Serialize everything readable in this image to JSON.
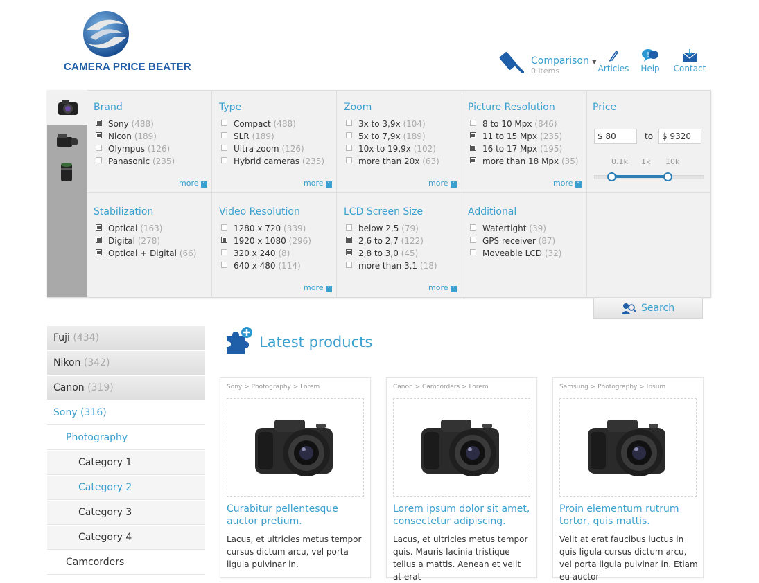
{
  "brand": {
    "name": "CAMERA PRICE BEATER"
  },
  "header": {
    "comparison": {
      "label": "Comparison",
      "sub": "0 items"
    },
    "nav": [
      {
        "label": "Articles",
        "icon": "pen-icon"
      },
      {
        "label": "Help",
        "icon": "speech-bubble-icon"
      },
      {
        "label": "Contact",
        "icon": "envelope-icon"
      }
    ]
  },
  "filters": {
    "row1": [
      {
        "title": "Brand",
        "items": [
          {
            "label": "Sony",
            "count": "(488)",
            "checked": true
          },
          {
            "label": "Nicon",
            "count": "(189)",
            "checked": true
          },
          {
            "label": "Olympus",
            "count": "(126)",
            "checked": false
          },
          {
            "label": "Panasonic",
            "count": "(235)",
            "checked": false
          }
        ]
      },
      {
        "title": "Type",
        "items": [
          {
            "label": "Compact",
            "count": "(488)",
            "checked": false
          },
          {
            "label": "SLR",
            "count": "(189)",
            "checked": false
          },
          {
            "label": "Ultra zoom",
            "count": "(126)",
            "checked": false
          },
          {
            "label": "Hybrid cameras",
            "count": "(235)",
            "checked": false
          }
        ]
      },
      {
        "title": "Zoom",
        "items": [
          {
            "label": "3x to 3,9x",
            "count": "(104)",
            "checked": false
          },
          {
            "label": "5x to 7,9x",
            "count": "(189)",
            "checked": false
          },
          {
            "label": "10x to 19,9x",
            "count": "(102)",
            "checked": false
          },
          {
            "label": "more than 20x",
            "count": "(63)",
            "checked": false
          }
        ]
      },
      {
        "title": "Picture Resolution",
        "items": [
          {
            "label": "8 to 10 Mpx",
            "count": "(846)",
            "checked": false
          },
          {
            "label": "11 to 15 Mpx",
            "count": "(235)",
            "checked": true
          },
          {
            "label": "16 to 17 Mpx",
            "count": "(195)",
            "checked": true
          },
          {
            "label": "more than 18 Mpx",
            "count": "(35)",
            "checked": true
          }
        ]
      }
    ],
    "row2": [
      {
        "title": "Stabilization",
        "items": [
          {
            "label": "Optical",
            "count": "(163)",
            "checked": true
          },
          {
            "label": "Digital",
            "count": "(278)",
            "checked": true
          },
          {
            "label": "Optical + Digital",
            "count": "(66)",
            "checked": true
          }
        ]
      },
      {
        "title": "Video Resolution",
        "items": [
          {
            "label": "1280 x 720",
            "count": "(339)",
            "checked": false
          },
          {
            "label": "1920 x 1080",
            "count": "(296)",
            "checked": true
          },
          {
            "label": "320 x 240",
            "count": "(8)",
            "checked": false
          },
          {
            "label": "640 x 480",
            "count": "(114)",
            "checked": false
          }
        ]
      },
      {
        "title": "LCD Screen Size",
        "items": [
          {
            "label": "below 2,5",
            "count": "(79)",
            "checked": false
          },
          {
            "label": "2,6 to 2,7",
            "count": "(122)",
            "checked": true
          },
          {
            "label": "2,8 to 3,0",
            "count": "(45)",
            "checked": true
          },
          {
            "label": "more than 3,1",
            "count": "(18)",
            "checked": false
          }
        ]
      },
      {
        "title": "Additional",
        "items": [
          {
            "label": "Watertight",
            "count": "(39)",
            "checked": false
          },
          {
            "label": "GPS receiver",
            "count": "(87)",
            "checked": false
          },
          {
            "label": "Moveable LCD",
            "count": "(32)",
            "checked": false
          }
        ]
      }
    ],
    "more_label": "more",
    "price": {
      "title": "Price",
      "min": "$ 80",
      "to": "to",
      "max": "$ 9320",
      "ticks": [
        "0.1k",
        "1k",
        "10k"
      ]
    }
  },
  "search_label": "Search",
  "sidebar": [
    {
      "label": "Fuji",
      "count": "(434)",
      "style": "gray"
    },
    {
      "label": "Nikon",
      "count": "(342)",
      "style": "gray"
    },
    {
      "label": "Canon",
      "count": "(319)",
      "style": "gray"
    },
    {
      "label": "Sony (316)",
      "count": "",
      "style": "active",
      "indent": 9
    },
    {
      "label": "Photography",
      "count": "",
      "style": "active",
      "indent": 27
    },
    {
      "label": "Category 1",
      "count": "",
      "style": "normal",
      "indent": 45
    },
    {
      "label": "Category 2",
      "count": "",
      "style": "active",
      "indent": 45
    },
    {
      "label": "Category 3",
      "count": "",
      "style": "normal",
      "indent": 45
    },
    {
      "label": "Category 4",
      "count": "",
      "style": "normal",
      "indent": 45
    },
    {
      "label": "Camcorders",
      "count": "",
      "style": "normal",
      "indent": 27
    }
  ],
  "latest": {
    "title": "Latest products",
    "products": [
      {
        "crumb": "Sony > Photography > Lorem",
        "title": "Curabitur pellentesque auctor pretium.",
        "desc": "Lacus, et ultricies metus tempor cursus dictum arcu, vel porta ligula pulvinar in."
      },
      {
        "crumb": "Canon > Camcorders > Lorem",
        "title": "Lorem ipsum dolor sit amet, consectetur adipiscing.",
        "desc": "Lacus, et ultricies metus tempor quis. Mauris lacinia tristique tellus a mattis. Aenean et velit at erat"
      },
      {
        "crumb": "Samsung  > Photography > Ipsum",
        "title": "Proin elementum rutrum tortor, quis mattis.",
        "desc": "Velit at erat faucibus luctus in quis ligula cursus dictum arcu, vel porta ligula pulvinar in. Etiam eu auctor"
      }
    ]
  },
  "colors": {
    "accent": "#3aa0cf",
    "brand": "#1f5ea8",
    "tabs_bg": "#a9a9a9",
    "slider": "#2b7fb8"
  }
}
